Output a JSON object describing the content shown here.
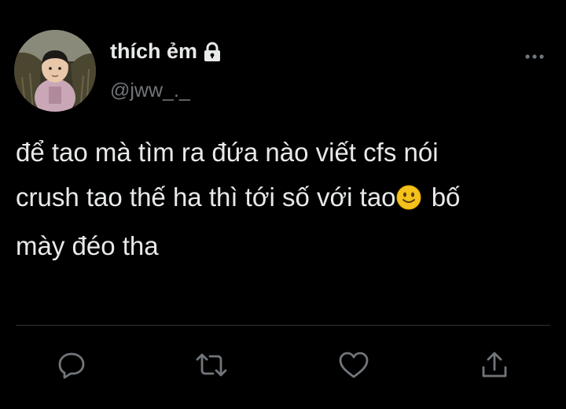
{
  "tweet": {
    "author": {
      "display_name": "thích ẻm",
      "handle": "@jww_._",
      "verified_icon": "lock-icon"
    },
    "body": {
      "line1": "để tao mà tìm ra đứa nào viết cfs nói",
      "line2_before_emoji": "crush tao thế ha thì tới số với tao",
      "emoji": "slightly-smiling-face-emoji",
      "line2_after_emoji": "bố",
      "line3": "mày đéo tha"
    },
    "actions": [
      {
        "icon": "reply-icon"
      },
      {
        "icon": "retweet-icon"
      },
      {
        "icon": "like-icon"
      },
      {
        "icon": "share-icon"
      }
    ]
  },
  "colors": {
    "background": "#000000",
    "text_primary": "#e7e9ea",
    "text_secondary": "#71767b",
    "divider": "#2f3336",
    "emoji_yellow": "#f5c21b"
  }
}
